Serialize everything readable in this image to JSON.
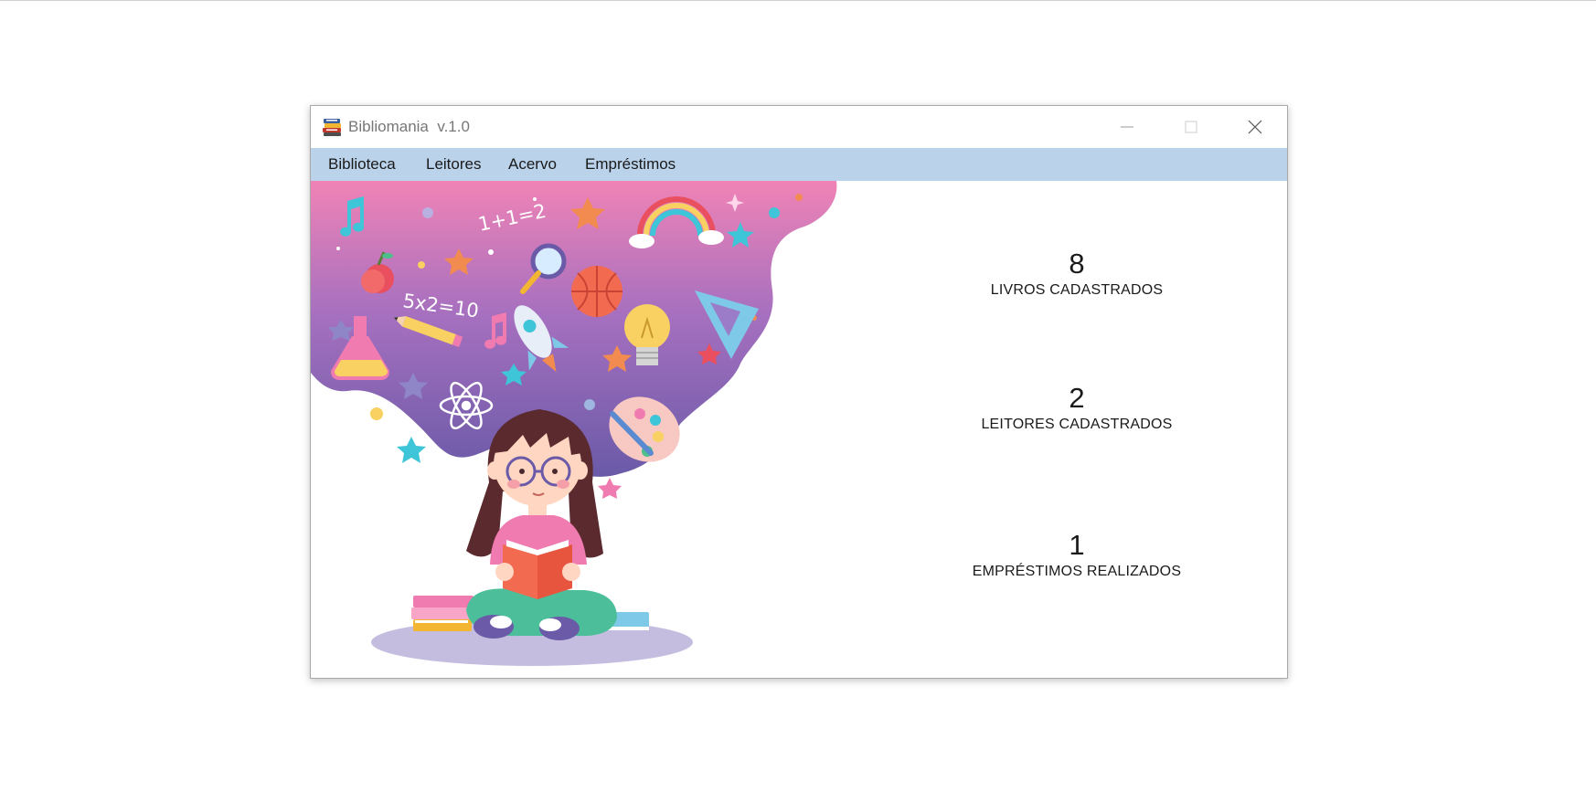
{
  "window": {
    "title": "Bibliomania  v.1.0"
  },
  "menu": {
    "items": [
      "Biblioteca",
      "Leitores",
      "Acervo",
      "Empréstimos"
    ]
  },
  "stats": [
    {
      "value": "8",
      "label": "LIVROS CADASTRADOS"
    },
    {
      "value": "2",
      "label": "LEITORES CADASTRADOS"
    },
    {
      "value": "1",
      "label": "EMPRÉSTIMOS REALIZADOS"
    }
  ],
  "illustration": {
    "math_1": "1+1=2",
    "math_2": "5x2=10"
  },
  "colors": {
    "menubar": "#bad2ea",
    "illustration_top": "#f083b6",
    "illustration_bottom": "#6a5aa8"
  },
  "icons": {
    "app": "book-stack-icon",
    "minimize": "minimize-icon",
    "maximize": "maximize-icon",
    "close": "close-icon"
  }
}
